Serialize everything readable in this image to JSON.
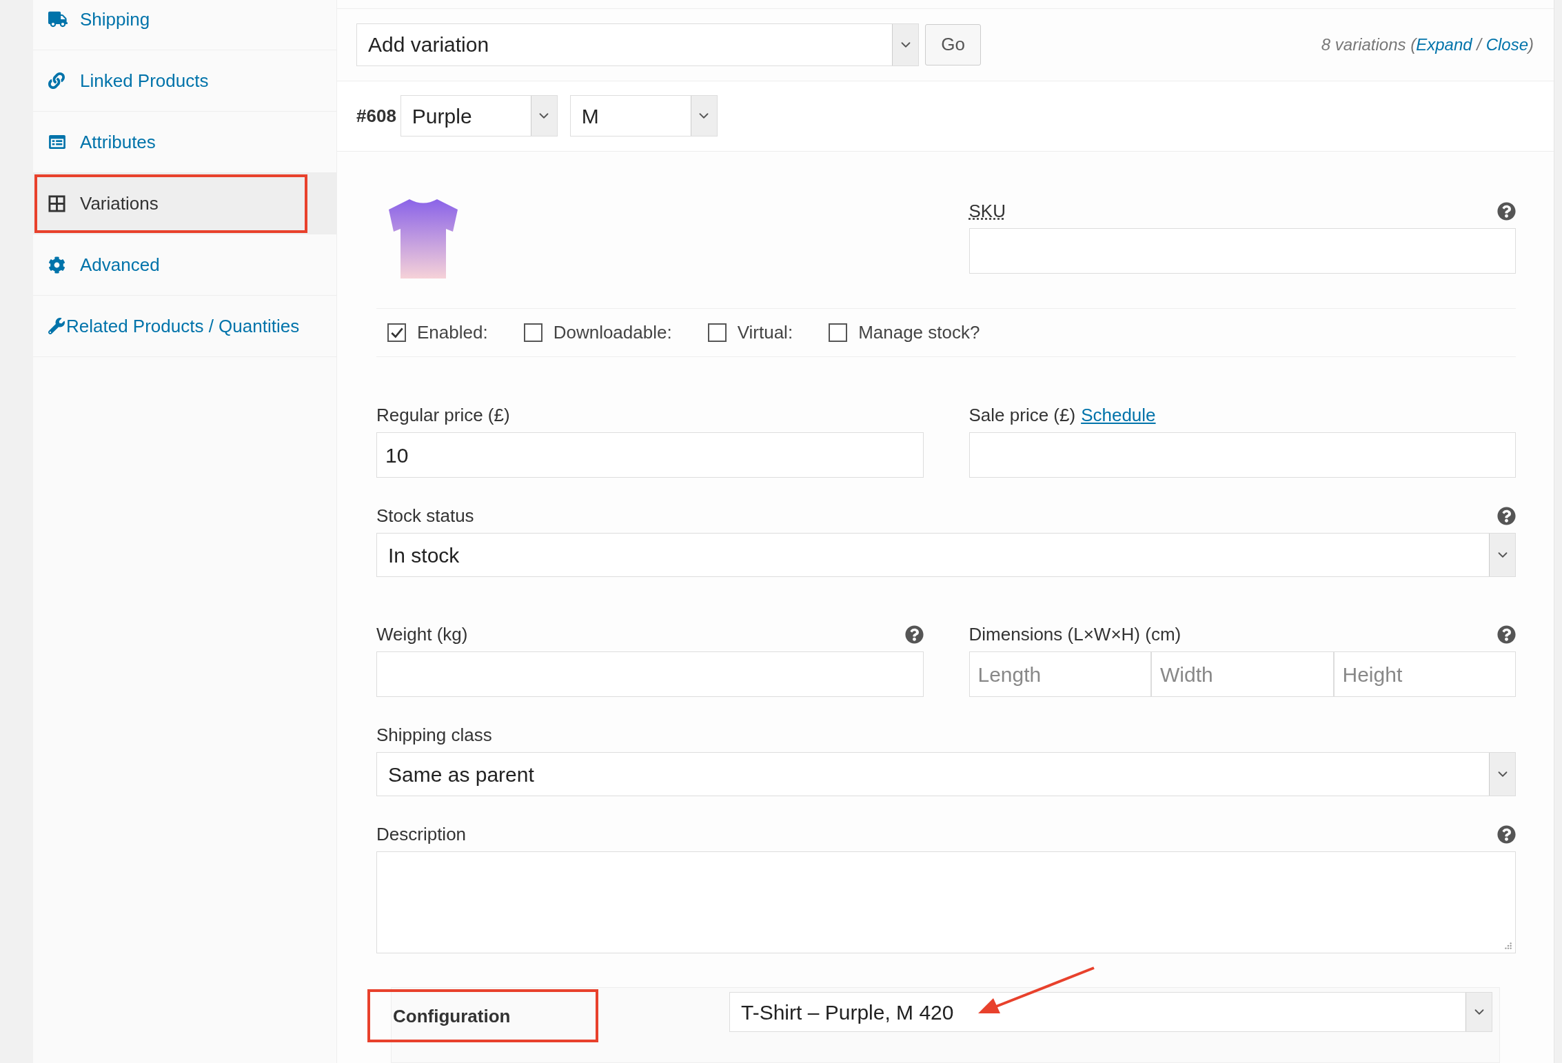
{
  "sidebar": {
    "items": [
      {
        "label": "Shipping",
        "kind": "truck",
        "selected": false
      },
      {
        "label": "Linked Products",
        "kind": "link",
        "selected": false
      },
      {
        "label": "Attributes",
        "kind": "list",
        "selected": false
      },
      {
        "label": "Variations",
        "kind": "grid",
        "selected": true
      },
      {
        "label": "Advanced",
        "kind": "gear",
        "selected": false
      },
      {
        "label": "Related Products / Quantities",
        "kind": "wrench",
        "selected": false
      }
    ]
  },
  "toolbar": {
    "bulk_action": "Add variation",
    "go": "Go",
    "count_prefix": "8 variations (",
    "expand": "Expand",
    "separator": " / ",
    "close": "Close",
    "count_suffix": ")"
  },
  "variation": {
    "id": "#608",
    "attributes": [
      "Purple",
      "M"
    ],
    "sku": {
      "label": "SKU",
      "help": true
    },
    "options": [
      {
        "label": "Enabled:",
        "checked": true
      },
      {
        "label": "Downloadable:",
        "checked": false
      },
      {
        "label": "Virtual:",
        "checked": false
      },
      {
        "label": "Manage stock?",
        "checked": false
      }
    ],
    "rows": [
      [
        {
          "kind": "text",
          "label": "Regular price (£)",
          "value": "10",
          "help": false
        },
        {
          "kind": "text",
          "label": "Sale price (£)",
          "link": "Schedule",
          "help": false
        }
      ],
      [
        {
          "kind": "select",
          "label": "Stock status",
          "value": "In stock",
          "help": true
        }
      ],
      [
        {
          "kind": "text",
          "label": "Weight (kg)",
          "help": true
        },
        {
          "kind": "dimensions",
          "label": "Dimensions (L×W×H) (cm)",
          "placeholders": [
            "Length",
            "Width",
            "Height"
          ],
          "help": true
        }
      ],
      [
        {
          "kind": "select",
          "label": "Shipping class",
          "value": "Same as parent",
          "help": false
        }
      ],
      [
        {
          "kind": "textarea",
          "label": "Description",
          "help": true
        }
      ]
    ],
    "configuration": {
      "label": "Configuration",
      "value": "T-Shirt – Purple, M 420"
    }
  }
}
